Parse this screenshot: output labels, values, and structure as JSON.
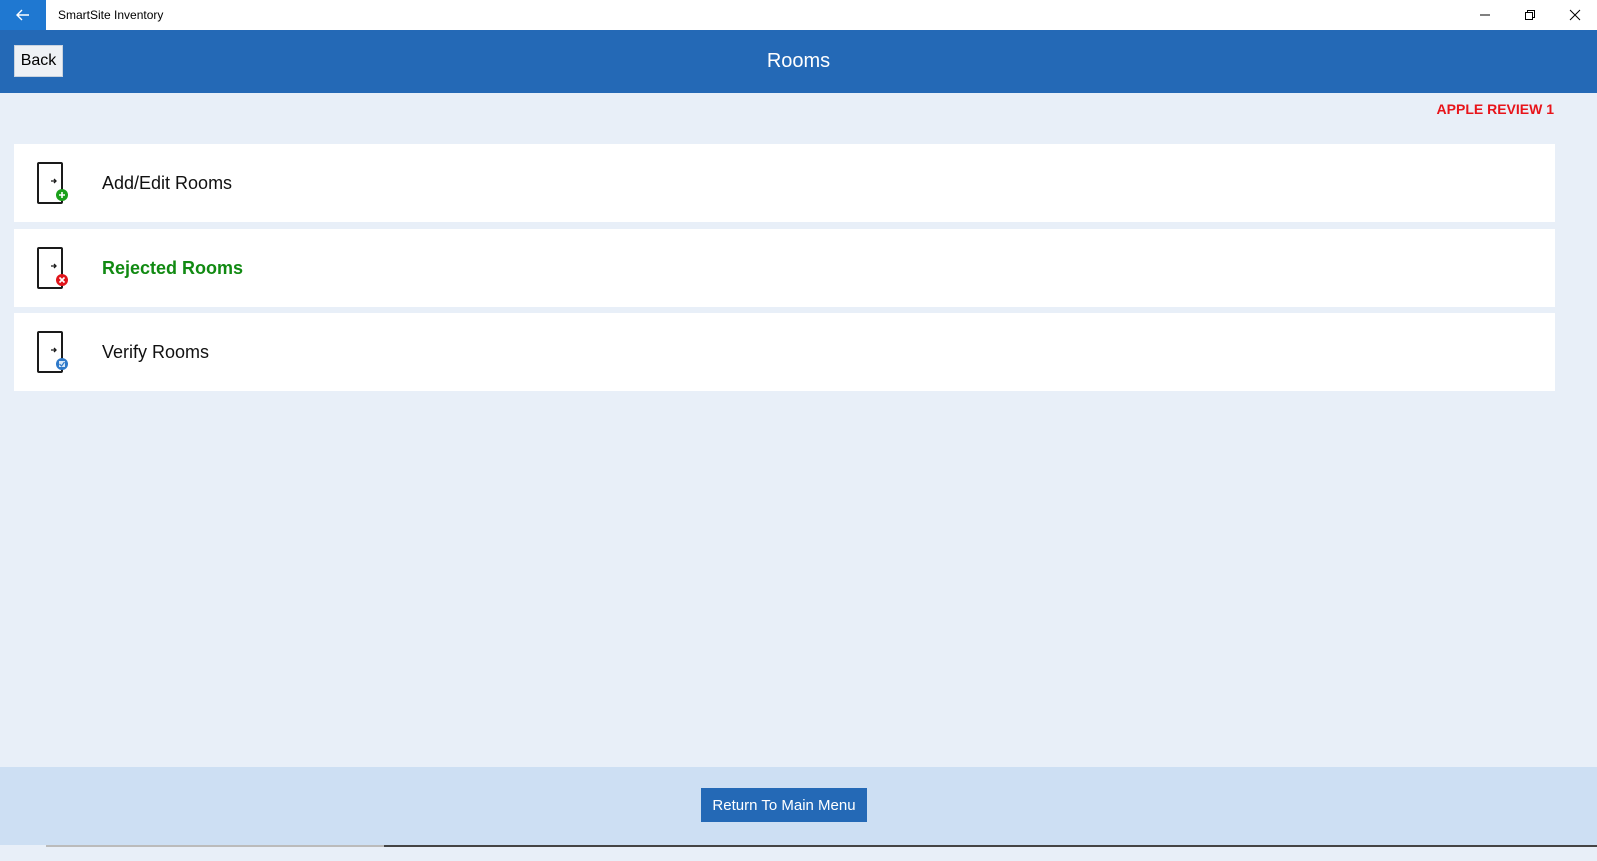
{
  "window": {
    "title": "SmartSite Inventory"
  },
  "header": {
    "back_label": "Back",
    "title": "Rooms"
  },
  "review_label": "APPLE REVIEW 1",
  "menu": {
    "items": [
      {
        "label": "Add/Edit Rooms",
        "icon": "door-add-icon",
        "badge_color": "#1aa01a"
      },
      {
        "label": "Rejected Rooms",
        "icon": "door-reject-icon",
        "badge_color": "#e0141a"
      },
      {
        "label": "Verify Rooms",
        "icon": "door-verify-icon",
        "badge_color": "#2e79c9"
      }
    ]
  },
  "footer": {
    "main_menu_label": "Return To Main Menu"
  },
  "colors": {
    "accent": "#2469b6",
    "titlebar_back": "#1f78d1",
    "review": "#e8141a",
    "rejected": "#118a12"
  }
}
